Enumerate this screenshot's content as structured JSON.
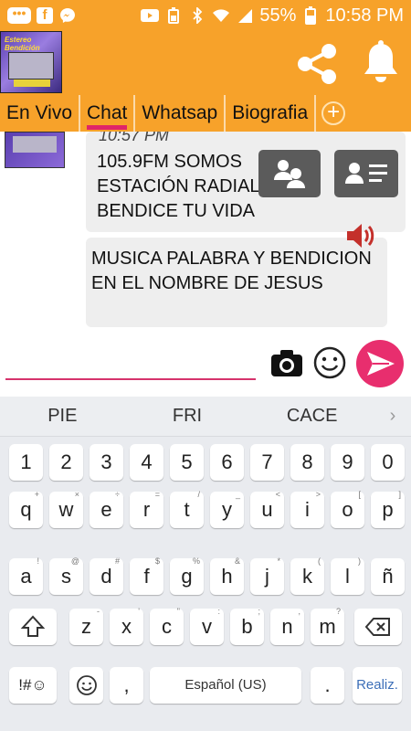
{
  "status_bar": {
    "battery_percent": "55%",
    "time": "10:58 PM"
  },
  "app_bar": {
    "logo_label": "Estereo Bendición"
  },
  "tabs": [
    {
      "label": "En Vivo"
    },
    {
      "label": "Chat"
    },
    {
      "label": "Whatsap"
    },
    {
      "label": "Biografia"
    }
  ],
  "chat": {
    "message1_time": "10:57 PM",
    "message1_text": "105.9FM SOMOS ESTACIÓN RADIAL QUE BENDICE TU VIDA",
    "message2_text": "MUSICA PALABRA Y BENDICION EN EL NOMBRE DE JESUS"
  },
  "input": {
    "message_value": ""
  },
  "keyboard": {
    "suggestions": [
      "PIE",
      "FRI",
      "CACE"
    ],
    "row_numbers": [
      "1",
      "2",
      "3",
      "4",
      "5",
      "6",
      "7",
      "8",
      "9",
      "0"
    ],
    "row1": [
      {
        "k": "q",
        "s": "+"
      },
      {
        "k": "w",
        "s": "×"
      },
      {
        "k": "e",
        "s": "÷"
      },
      {
        "k": "r",
        "s": "="
      },
      {
        "k": "t",
        "s": "/"
      },
      {
        "k": "y",
        "s": "_"
      },
      {
        "k": "u",
        "s": "<"
      },
      {
        "k": "i",
        "s": ">"
      },
      {
        "k": "o",
        "s": "["
      },
      {
        "k": "p",
        "s": "]"
      }
    ],
    "row2": [
      {
        "k": "a",
        "s": "!"
      },
      {
        "k": "s",
        "s": "@"
      },
      {
        "k": "d",
        "s": "#"
      },
      {
        "k": "f",
        "s": "$"
      },
      {
        "k": "g",
        "s": "%"
      },
      {
        "k": "h",
        "s": "&"
      },
      {
        "k": "j",
        "s": "*"
      },
      {
        "k": "k",
        "s": "("
      },
      {
        "k": "l",
        "s": ")"
      },
      {
        "k": "ñ",
        "s": ""
      }
    ],
    "row3": [
      {
        "k": "z",
        "s": "-"
      },
      {
        "k": "x",
        "s": "'"
      },
      {
        "k": "c",
        "s": "\""
      },
      {
        "k": "v",
        "s": ":"
      },
      {
        "k": "b",
        "s": ";"
      },
      {
        "k": "n",
        "s": ","
      },
      {
        "k": "m",
        "s": "?"
      }
    ],
    "symbols_label": "!#☺",
    "comma": ",",
    "space_label": "Español (US)",
    "period": ".",
    "action_label": "Realiz."
  }
}
